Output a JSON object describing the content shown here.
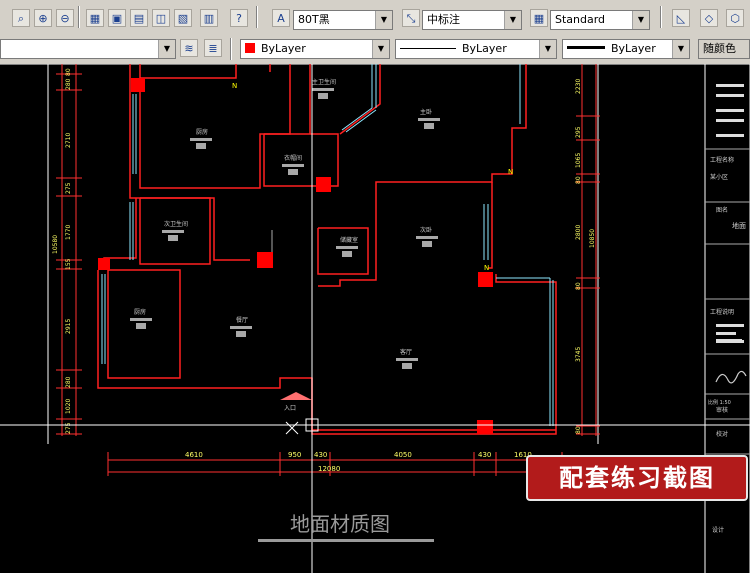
{
  "toolbar1": {
    "text_style": "80T黑",
    "dim_style": "中标注",
    "table_style": "Standard"
  },
  "toolbar2": {
    "color": "ByLayer",
    "linetype": "ByLayer",
    "lineweight": "ByLayer",
    "plot_style": "随颜色"
  },
  "colors": {
    "toolbar_bg": "#d4d0c8",
    "wall": "#ff2020",
    "window": "#8ee8ff",
    "accent_red": "#b21b1b"
  },
  "drawing": {
    "rooms": [
      "厨房",
      "主卫生间",
      "主卧",
      "衣帽间",
      "次卫生间",
      "次卧",
      "储藏室",
      "厨房",
      "餐厅",
      "客厅",
      "入口"
    ],
    "dims_left": [
      "80",
      "280",
      "2710",
      "275",
      "1770",
      "155",
      "2915",
      "280",
      "1020",
      "275"
    ],
    "dim_left_total": "10580",
    "dims_right": [
      "2230",
      "295",
      "1065",
      "80",
      "2800",
      "80",
      "3745",
      "80"
    ],
    "dim_right_total": "10850",
    "dims_bottom": [
      "4610",
      "950",
      "430",
      "4050",
      "430",
      "1610"
    ],
    "dim_bottom_total": "12080",
    "title_block": [
      "工程名称",
      "某小区",
      "图名",
      "地面",
      "工程说明",
      "比例 1:50",
      "审核",
      "校对",
      "设计"
    ]
  },
  "overlay_badge": "配套练习截图",
  "caption": "地面材质图"
}
